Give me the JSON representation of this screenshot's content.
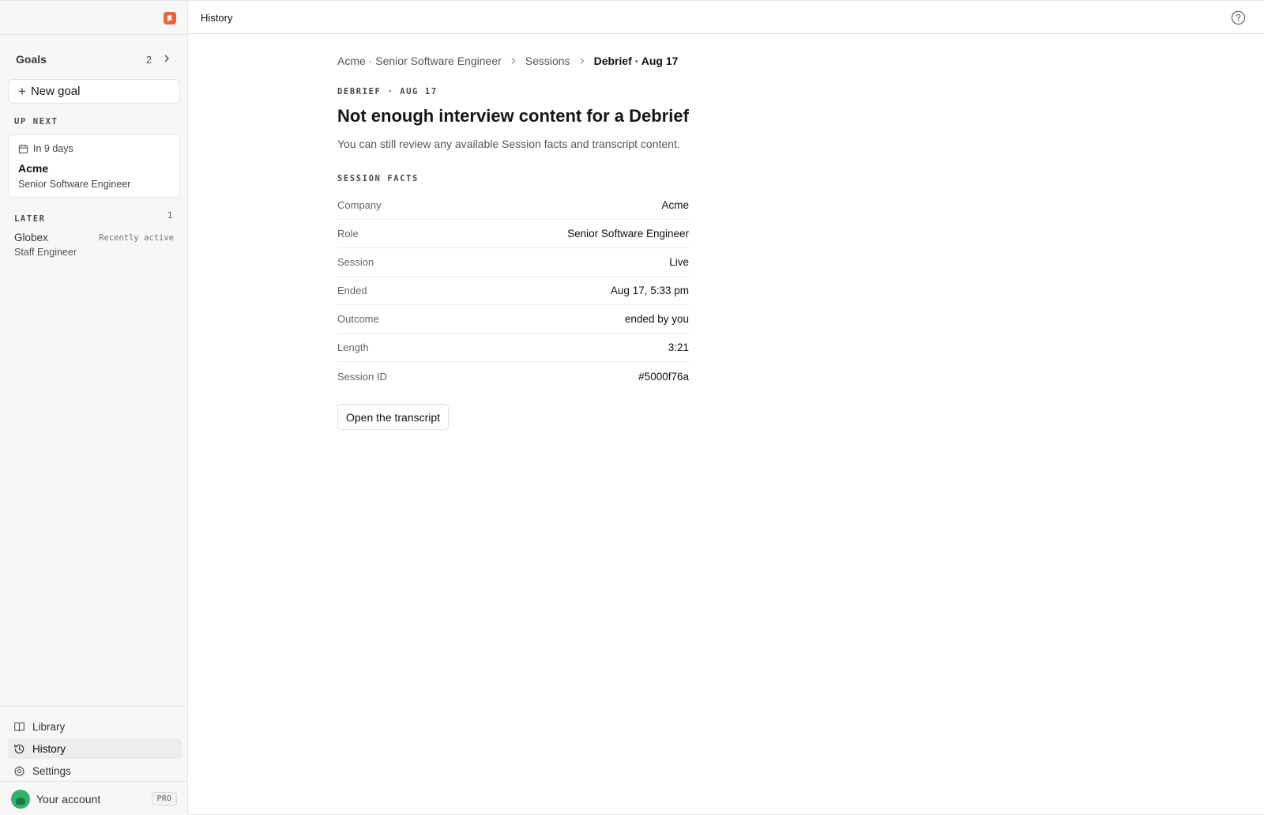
{
  "app": {
    "title": "History"
  },
  "sidebar": {
    "goals": {
      "title": "Goals",
      "count": "2"
    },
    "new_goal_label": "New goal",
    "up_next": {
      "label": "UP NEXT",
      "when": "In 9 days",
      "company": "Acme",
      "role": "Senior Software Engineer"
    },
    "later": {
      "label": "LATER",
      "count": "1",
      "items": [
        {
          "company": "Globex",
          "role": "Staff Engineer",
          "status": "Recently active"
        }
      ]
    },
    "nav": [
      {
        "label": "Library",
        "icon": "book-icon"
      },
      {
        "label": "History",
        "icon": "history-icon",
        "active": true
      },
      {
        "label": "Settings",
        "icon": "gear-icon"
      }
    ],
    "account": {
      "label": "Your account",
      "badge": "PRO"
    }
  },
  "breadcrumb": [
    {
      "label": "Acme · Senior Software Engineer"
    },
    {
      "label": "Sessions"
    },
    {
      "label": "Debrief · Aug 17"
    }
  ],
  "debrief": {
    "eyebrow": "DEBRIEF · AUG 17",
    "title": "Not enough interview content for a Debrief",
    "subtitle": "You can still review any available Session facts and transcript content."
  },
  "session_facts": {
    "label": "SESSION FACTS",
    "rows": [
      {
        "key": "Company",
        "value": "Acme"
      },
      {
        "key": "Role",
        "value": "Senior Software Engineer"
      },
      {
        "key": "Session",
        "value": "Live"
      },
      {
        "key": "Ended",
        "value": "Aug 17, 5:33 pm"
      },
      {
        "key": "Outcome",
        "value": "ended by you"
      },
      {
        "key": "Length",
        "value": "3:21"
      },
      {
        "key": "Session ID",
        "value": "#5000f76a"
      }
    ]
  },
  "actions": {
    "open_transcript": "Open the transcript"
  },
  "colors": {
    "brand": "#f0623a",
    "avatar": "#2fb36a"
  }
}
